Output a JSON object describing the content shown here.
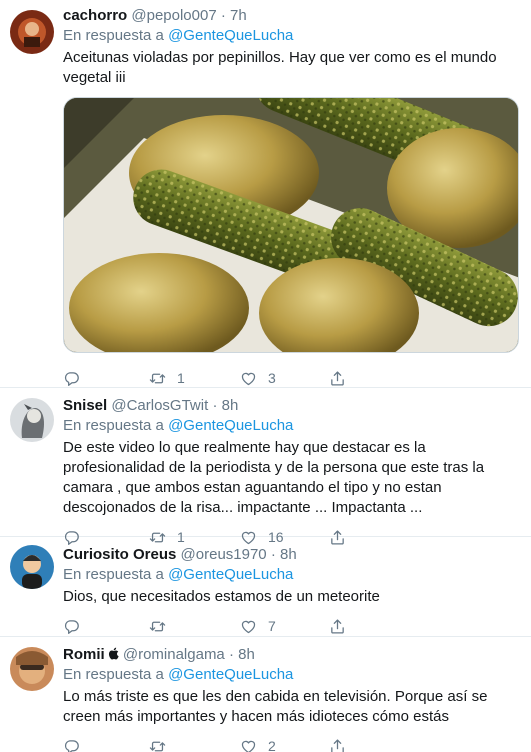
{
  "tweets": [
    {
      "name": "cachorro",
      "handle": "@pepolo007",
      "time": "7h",
      "reply_prefix": "En respuesta a",
      "reply_to": "@GenteQueLucha",
      "text": "Aceitunas violadas por pepinillos. Hay que ver como es el mundo vegetal iii",
      "replies": "",
      "retweets": "1",
      "likes": "3"
    },
    {
      "name": "Snisel",
      "handle": "@CarlosGTwit",
      "time": "8h",
      "reply_prefix": "En respuesta a",
      "reply_to": "@GenteQueLucha",
      "text": "De este video lo que realmente hay que destacar es la profesionalidad de la periodista y de la persona que este tras la camara , que ambos estan aguantando el tipo y no estan descojonados de la risa... impactante ... Impactanta ...",
      "replies": "",
      "retweets": "1",
      "likes": "16"
    },
    {
      "name": "Curiosito Oreus",
      "handle": "@oreus1970",
      "time": "8h",
      "reply_prefix": "En respuesta a",
      "reply_to": "@GenteQueLucha",
      "text": "Dios, que necesitados estamos de un meteorite",
      "replies": "",
      "retweets": "",
      "likes": "7"
    },
    {
      "name": "Romii",
      "handle": "@rominalgama",
      "time": "8h",
      "reply_prefix": "En respuesta a",
      "reply_to": "@GenteQueLucha",
      "text": "Lo más triste es que les den cabida en televisión. Porque así se creen más importantes y hacen más idioteces cómo estás",
      "replies": "",
      "retweets": "",
      "likes": "2"
    }
  ],
  "icons": {
    "reply": "reply-icon",
    "retweet": "retweet-icon",
    "like": "like-icon",
    "share": "share-icon",
    "apple": "apple-icon"
  },
  "colors": {
    "link": "#1b95e0",
    "secondary_text": "#657786",
    "divider": "#e6ecf0"
  }
}
